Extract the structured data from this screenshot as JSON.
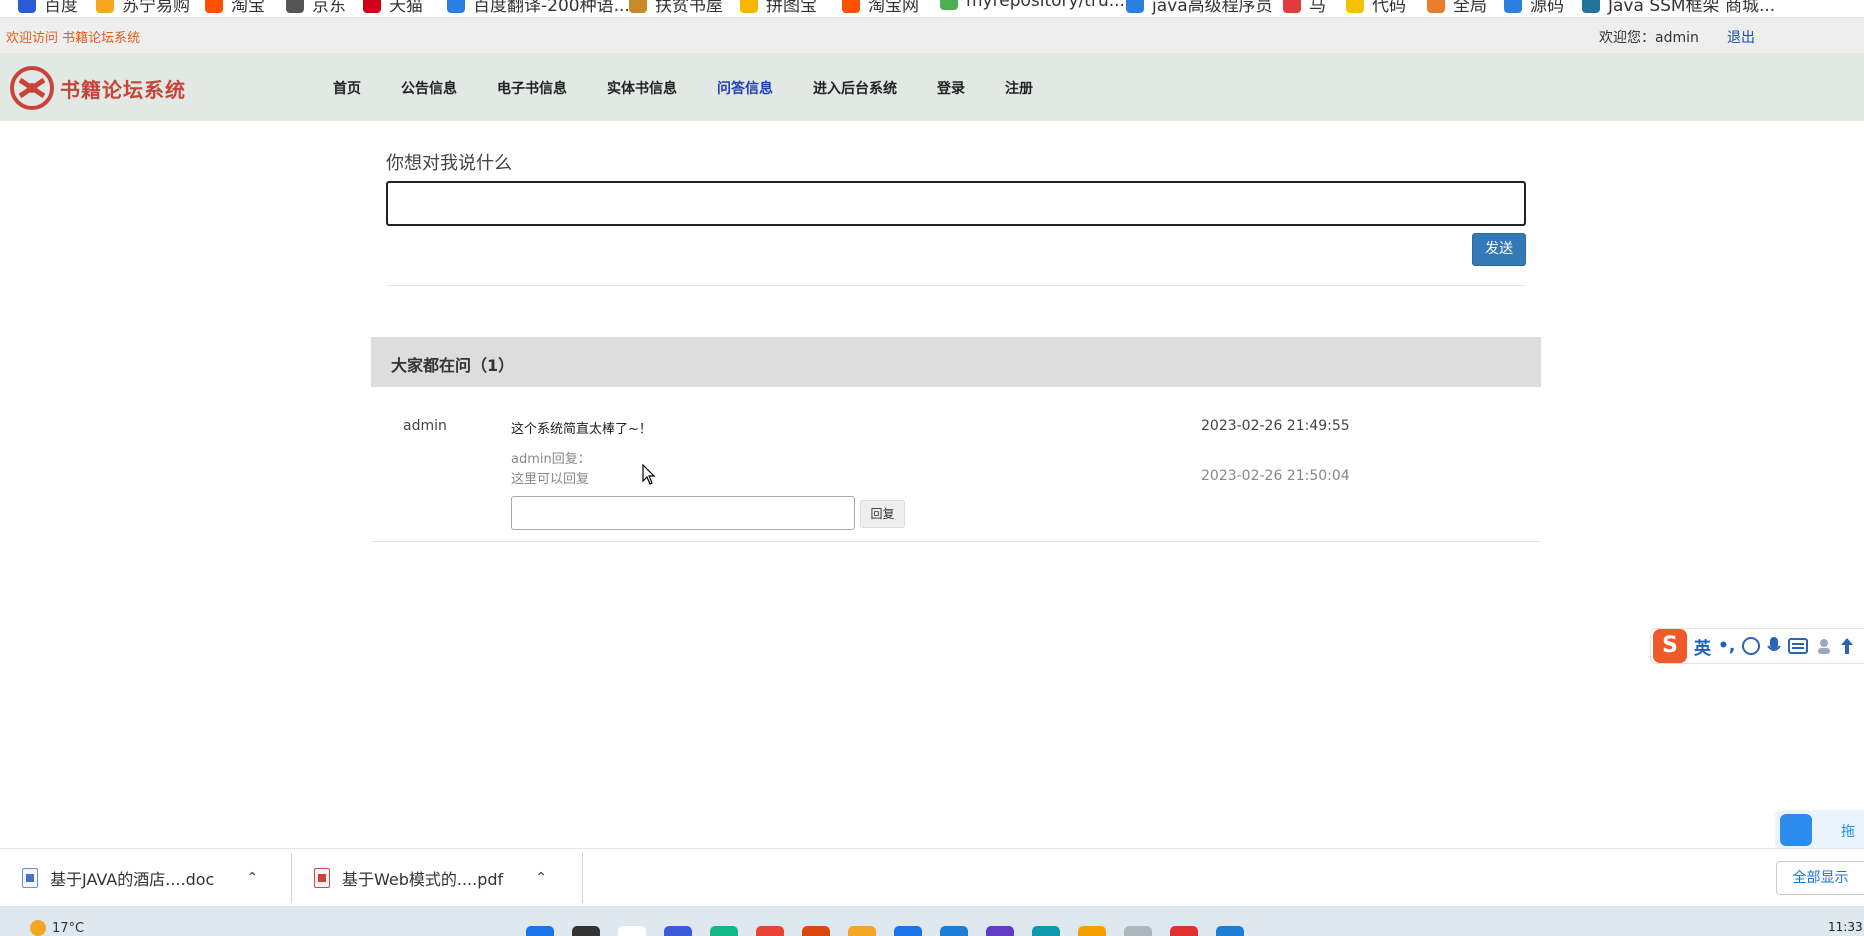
{
  "bookmarks": [
    {
      "label": "百度",
      "color": "#2b5ad6"
    },
    {
      "label": "苏宁易购",
      "color": "#f5a623"
    },
    {
      "label": "淘宝",
      "color": "#ff5000"
    },
    {
      "label": "京东",
      "color": "#555555"
    },
    {
      "label": "天猫",
      "color": "#d0021b"
    },
    {
      "label": "百度翻译-200种语...",
      "color": "#2b7fe0"
    },
    {
      "label": "扶贫书屋",
      "color": "#c98b2a"
    },
    {
      "label": "拼图宝",
      "color": "#f7b500"
    },
    {
      "label": "淘宝网",
      "color": "#ff5000"
    },
    {
      "label": "myrepository/tru...",
      "color": "#4caf50"
    },
    {
      "label": "java高级程序员",
      "color": "#2b7fe0"
    },
    {
      "label": "马",
      "color": "#e23b3b"
    },
    {
      "label": "代码",
      "color": "#f2c200"
    },
    {
      "label": "全局",
      "color": "#e97c2a"
    },
    {
      "label": "源码",
      "color": "#2b7fe0"
    },
    {
      "label": "Java SSM框架 商城...",
      "color": "#21759b"
    }
  ],
  "topbar": {
    "welcome": "欢迎访问 书籍论坛系统",
    "user_info": "欢迎您：admin",
    "logout": "退出"
  },
  "nav": {
    "logo_text": "书籍论坛系统",
    "items": [
      "首页",
      "公告信息",
      "电子书信息",
      "实体书信息",
      "问答信息",
      "进入后台系统",
      "登录",
      "注册"
    ],
    "active": "问答信息"
  },
  "ask": {
    "label": "你想对我说什么",
    "input_value": "",
    "send_label": "发送"
  },
  "list": {
    "header": "大家都在问（1）",
    "questions": [
      {
        "user": "admin",
        "text": "这个系统简直太棒了~！",
        "time": "2023-02-26 21:49:55",
        "reply_label": "admin回复：",
        "reply_text": "这里可以回复",
        "reply_time": "2023-02-26 21:50:04",
        "reply_input_value": "",
        "reply_button": "回复"
      }
    ]
  },
  "ime": {
    "logo": "S",
    "mode": "英",
    "punct": "•,"
  },
  "side_widget": {
    "label": "拖"
  },
  "downloads": {
    "items": [
      {
        "name": "基于JAVA的酒店....doc",
        "type": "doc"
      },
      {
        "name": "基于Web模式的....pdf",
        "type": "pdf"
      }
    ],
    "show_all": "全部显示"
  },
  "taskbar": {
    "temperature": "17°C",
    "clock": "11:33",
    "app_colors": [
      "#1a73e8",
      "#333333",
      "#ffffff",
      "#3b5bdb",
      "#12b886",
      "#ea4335",
      "#d9480f",
      "#f5a623",
      "#1a73e8",
      "#1c7ed6",
      "#5f3dc4",
      "#1098ad",
      "#f59f00",
      "#adb5bd",
      "#e03131",
      "#1c7ed6"
    ]
  }
}
